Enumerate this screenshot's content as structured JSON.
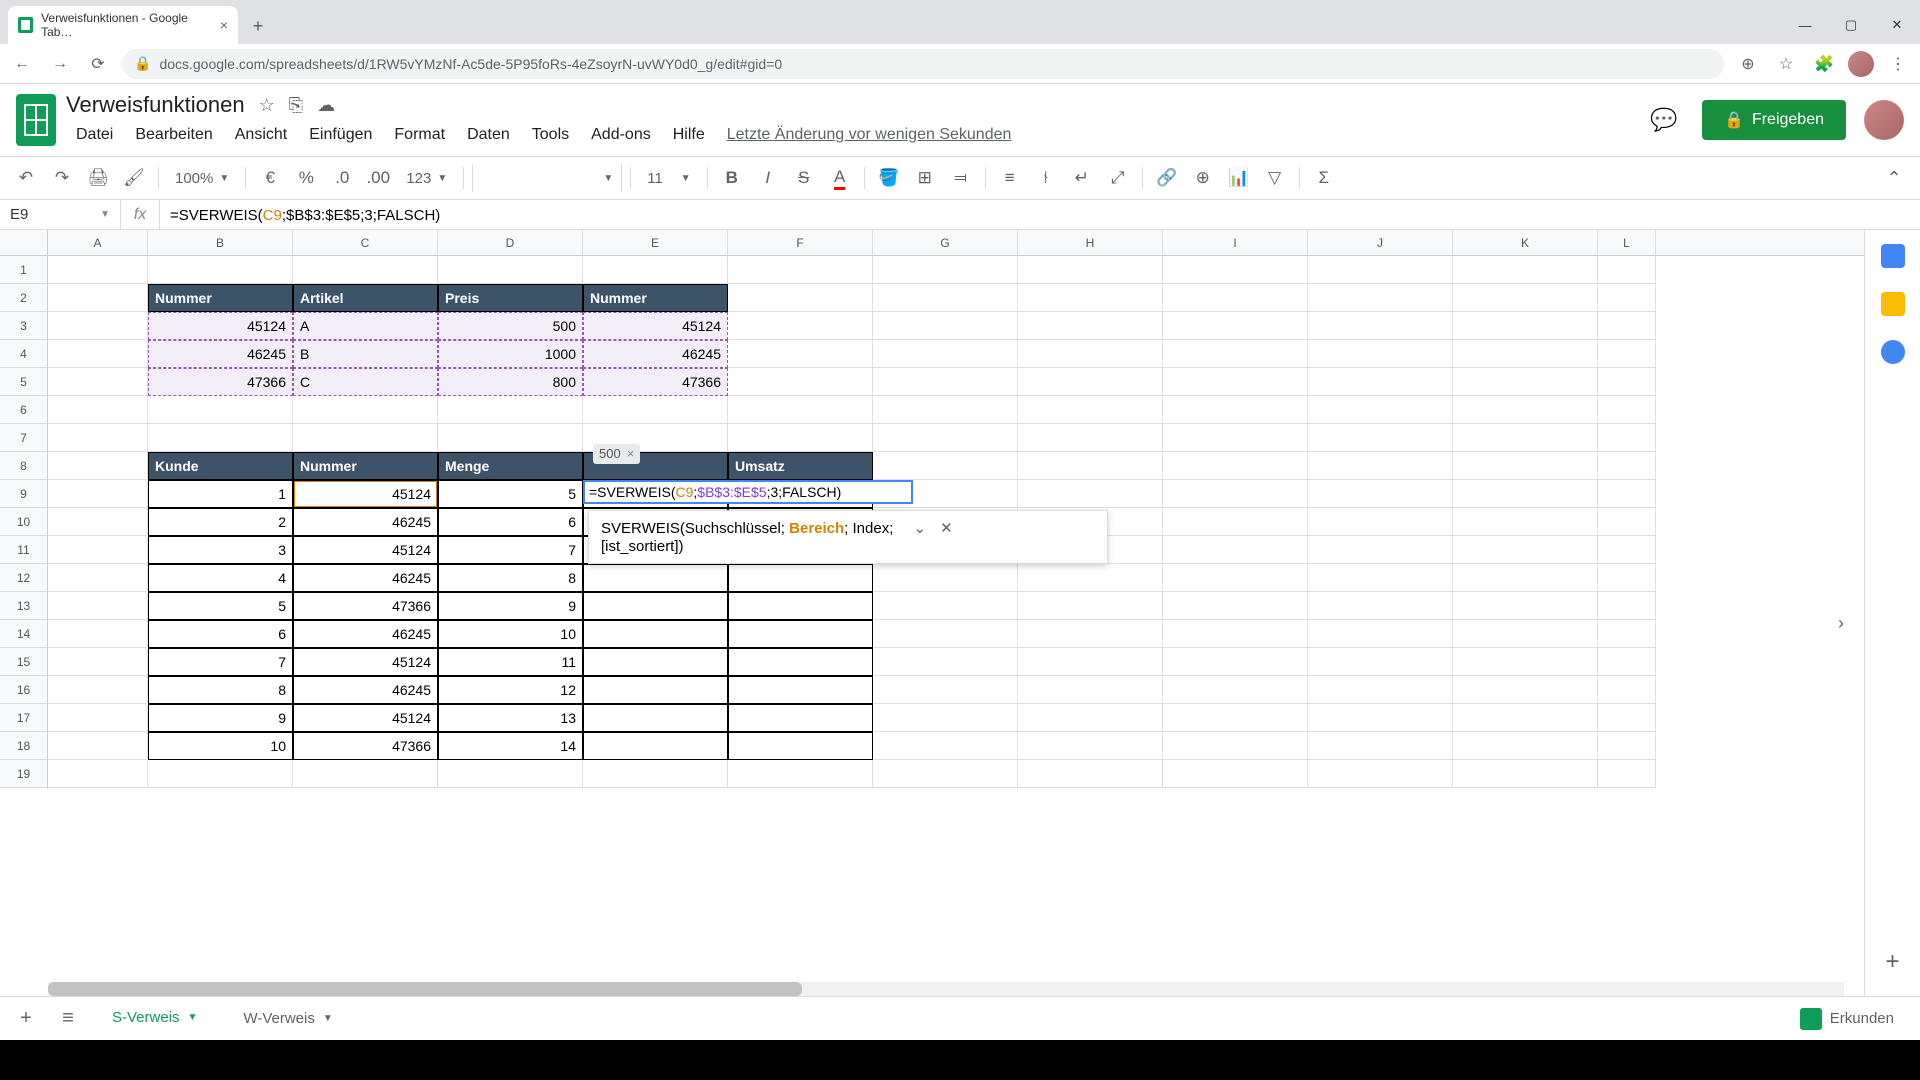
{
  "browser": {
    "tab_title": "Verweisfunktionen - Google Tab…",
    "url": "docs.google.com/spreadsheets/d/1RW5vYMzNf-Ac5de-5P95foRs-4eZsoyrN-uvWY0d0_g/edit#gid=0"
  },
  "doc": {
    "title": "Verweisfunktionen",
    "last_edit": "Letzte Änderung vor wenigen Sekunden",
    "share": "Freigeben"
  },
  "menus": [
    "Datei",
    "Bearbeiten",
    "Ansicht",
    "Einfügen",
    "Format",
    "Daten",
    "Tools",
    "Add-ons",
    "Hilfe"
  ],
  "toolbar": {
    "zoom": "100%",
    "font_size": "11",
    "number_fmt": "123"
  },
  "formula_bar": {
    "cell_ref": "E9",
    "formula_prefix": "=SVERWEIS(",
    "formula_c9": "C9",
    "formula_mid": ";$B$3:$E$5;3;FALSCH)"
  },
  "columns": [
    "A",
    "B",
    "C",
    "D",
    "E",
    "F",
    "G",
    "H",
    "I",
    "J",
    "K",
    "L"
  ],
  "table1": {
    "headers": [
      "Nummer",
      "Artikel",
      "Preis",
      "Nummer"
    ],
    "rows": [
      [
        "45124",
        "A",
        "500",
        "45124"
      ],
      [
        "46245",
        "B",
        "1000",
        "46245"
      ],
      [
        "47366",
        "C",
        "800",
        "47366"
      ]
    ]
  },
  "table2": {
    "headers": [
      "Kunde",
      "Nummer",
      "Menge",
      "",
      "Umsatz"
    ],
    "rows": [
      [
        "1",
        "45124",
        "5"
      ],
      [
        "2",
        "46245",
        "6"
      ],
      [
        "3",
        "45124",
        "7"
      ],
      [
        "4",
        "46245",
        "8"
      ],
      [
        "5",
        "47366",
        "9"
      ],
      [
        "6",
        "46245",
        "10"
      ],
      [
        "7",
        "45124",
        "11"
      ],
      [
        "8",
        "46245",
        "12"
      ],
      [
        "9",
        "45124",
        "13"
      ],
      [
        "10",
        "47366",
        "14"
      ]
    ]
  },
  "edit": {
    "result_preview": "500",
    "formula": "=SVERWEIS(C9;$B$3:$E$5;3;FALSCH)",
    "hint_fn": "SVERWEIS(",
    "hint_arg1": "Suchschlüssel",
    "hint_arg_active": "Bereich",
    "hint_arg3": "Index",
    "hint_rest": "[ist_sortiert])"
  },
  "sheets": {
    "add": "+",
    "tabs": [
      "S-Verweis",
      "W-Verweis"
    ],
    "explore": "Erkunden"
  }
}
